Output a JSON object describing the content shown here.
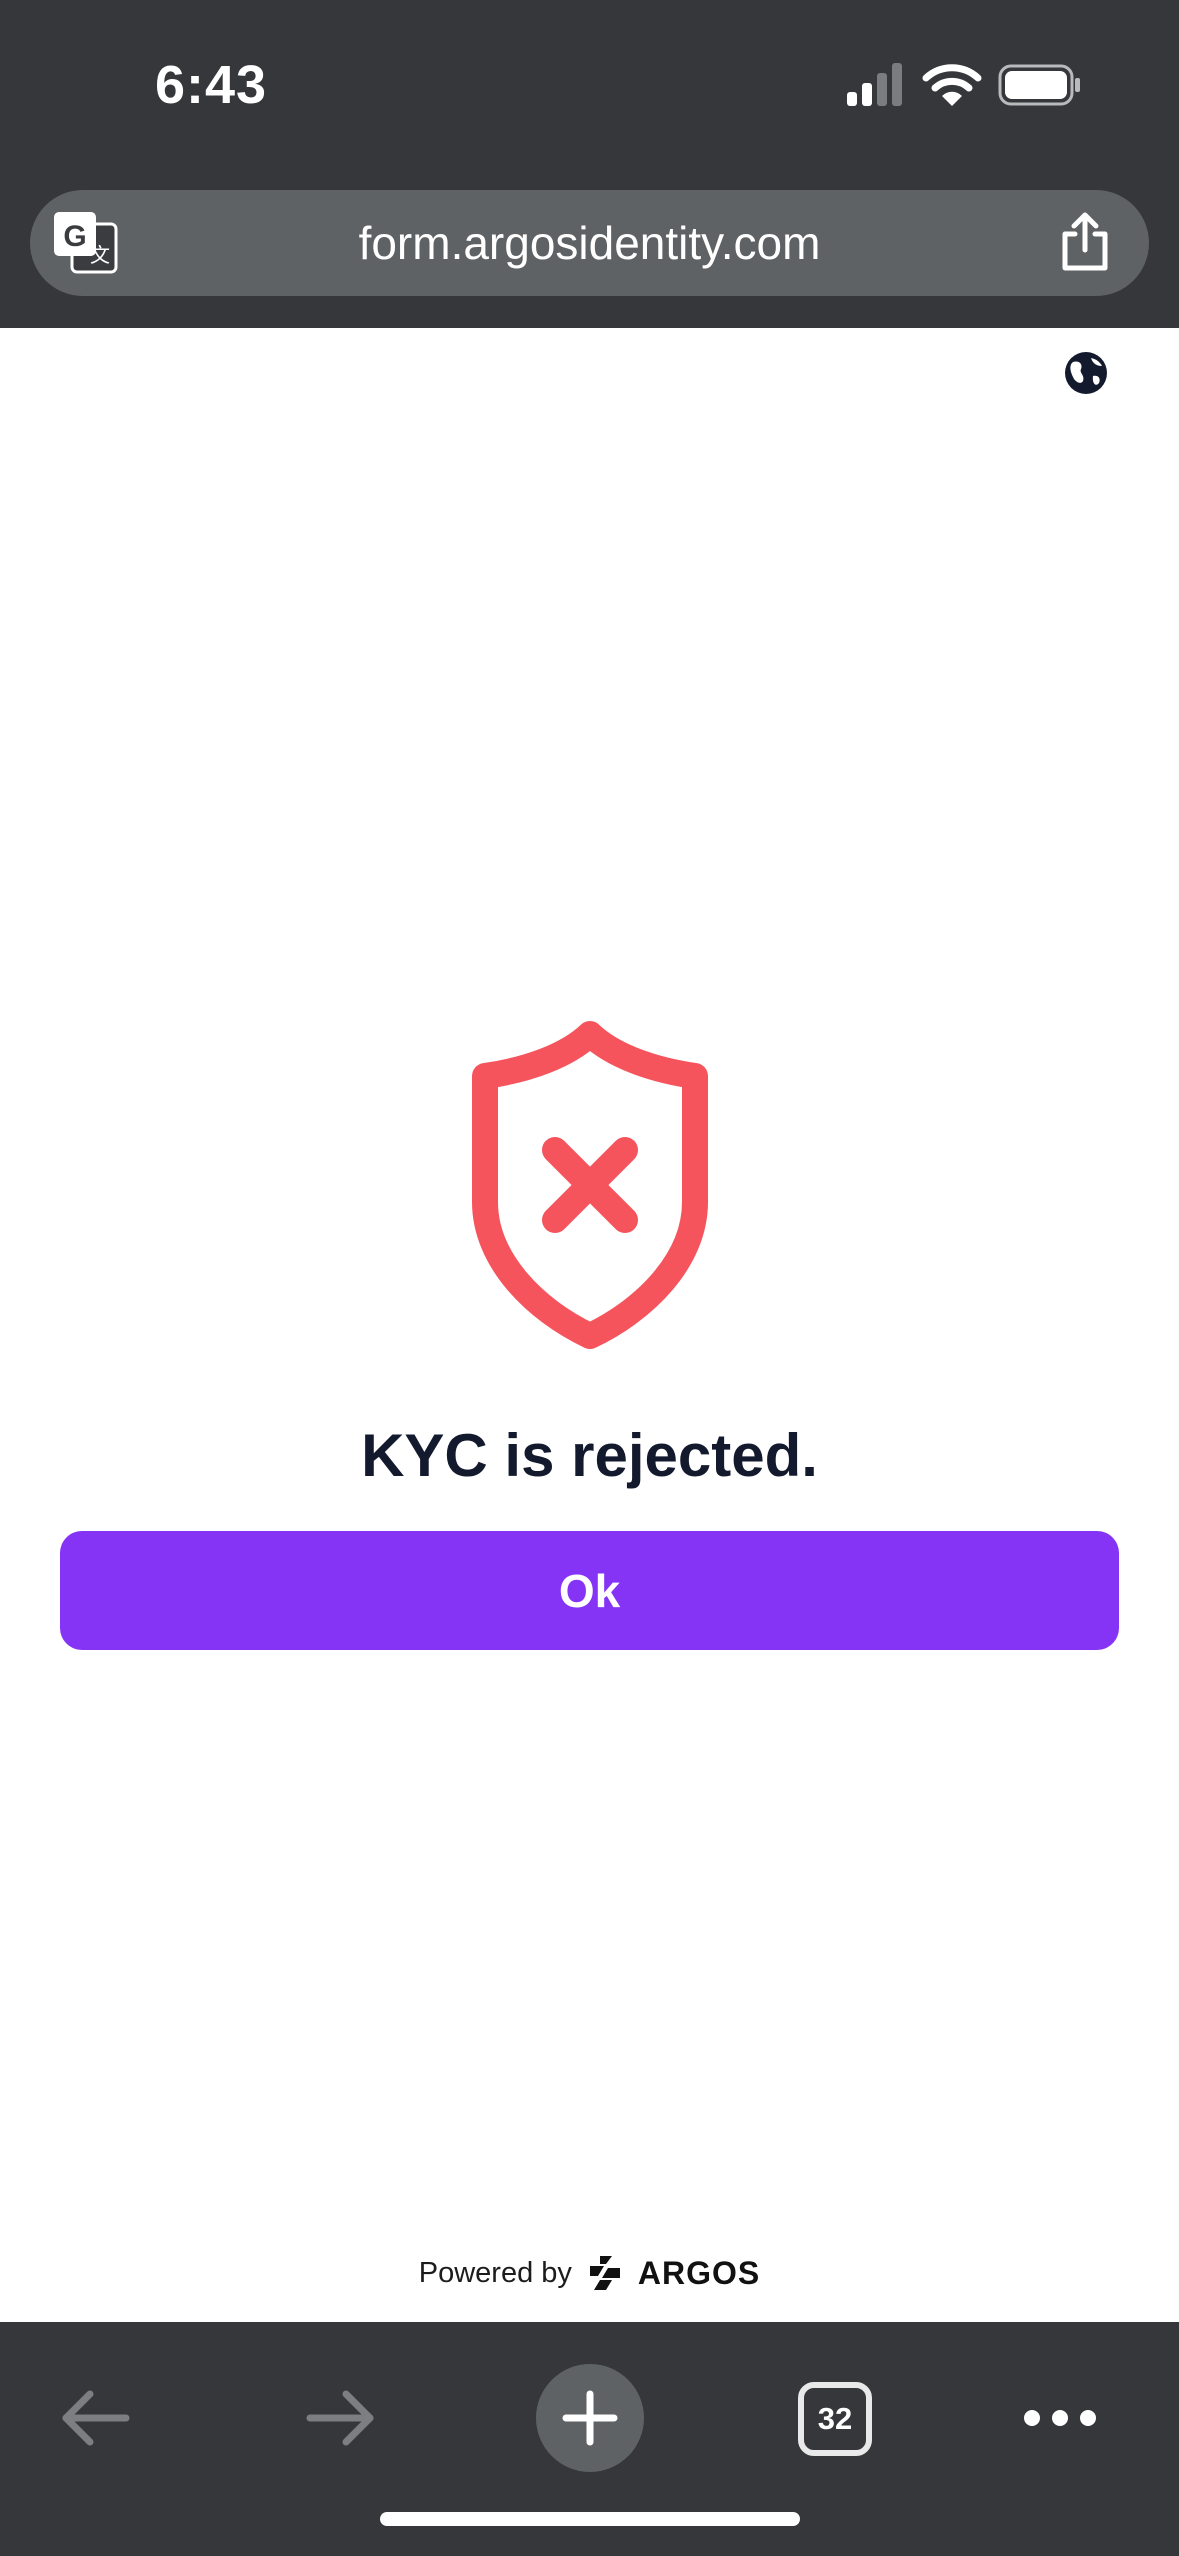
{
  "status_bar": {
    "time": "6:43"
  },
  "browser": {
    "url": "form.argosidentity.com",
    "tab_count": "32"
  },
  "result": {
    "title": "KYC is rejected.",
    "ok_label": "Ok",
    "shield_color": "#f5545d"
  },
  "footer": {
    "powered_by": "Powered by",
    "brand": "ARGOS"
  },
  "colors": {
    "accent": "#8534f6",
    "chrome": "#35373a",
    "url_bar": "#5f6264",
    "title_text": "#141a2e"
  },
  "icons": {
    "translate": "translate-icon",
    "share": "share-icon",
    "globe": "globe-icon",
    "shield": "shield-x-icon",
    "back": "back-arrow-icon",
    "forward": "forward-arrow-icon",
    "new_tab": "plus-icon",
    "more": "more-icon"
  }
}
